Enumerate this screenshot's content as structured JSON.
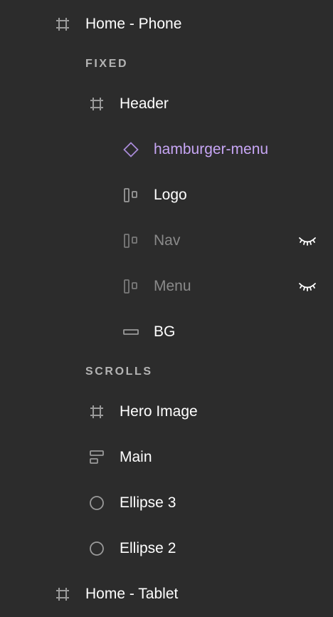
{
  "layers": {
    "home_phone": {
      "label": "Home - Phone",
      "icon": "frame-icon"
    },
    "fixed_section": {
      "label": "FIXED"
    },
    "header": {
      "label": "Header",
      "icon": "frame-icon"
    },
    "hamburger_menu": {
      "label": "hamburger-menu",
      "icon": "component-instance-icon",
      "color": "#c7a6f5"
    },
    "logo": {
      "label": "Logo",
      "icon": "auto-layout-icon"
    },
    "nav": {
      "label": "Nav",
      "icon": "auto-layout-icon",
      "hidden": true
    },
    "menu": {
      "label": "Menu",
      "icon": "auto-layout-icon",
      "hidden": true
    },
    "bg": {
      "label": "BG",
      "icon": "rectangle-icon"
    },
    "scrolls_section": {
      "label": "SCROLLS"
    },
    "hero_image": {
      "label": "Hero Image",
      "icon": "frame-icon"
    },
    "main": {
      "label": "Main",
      "icon": "auto-layout-vertical-icon"
    },
    "ellipse_3": {
      "label": "Ellipse 3",
      "icon": "ellipse-icon"
    },
    "ellipse_2": {
      "label": "Ellipse 2",
      "icon": "ellipse-icon"
    },
    "home_tablet": {
      "label": "Home - Tablet",
      "icon": "frame-icon"
    }
  },
  "colors": {
    "background": "#2c2c2c",
    "text": "#ffffff",
    "hidden_text": "#8a8a8a",
    "section_text": "#b4b4b4",
    "component": "#c7a6f5",
    "icon": "#9a9a9a"
  }
}
